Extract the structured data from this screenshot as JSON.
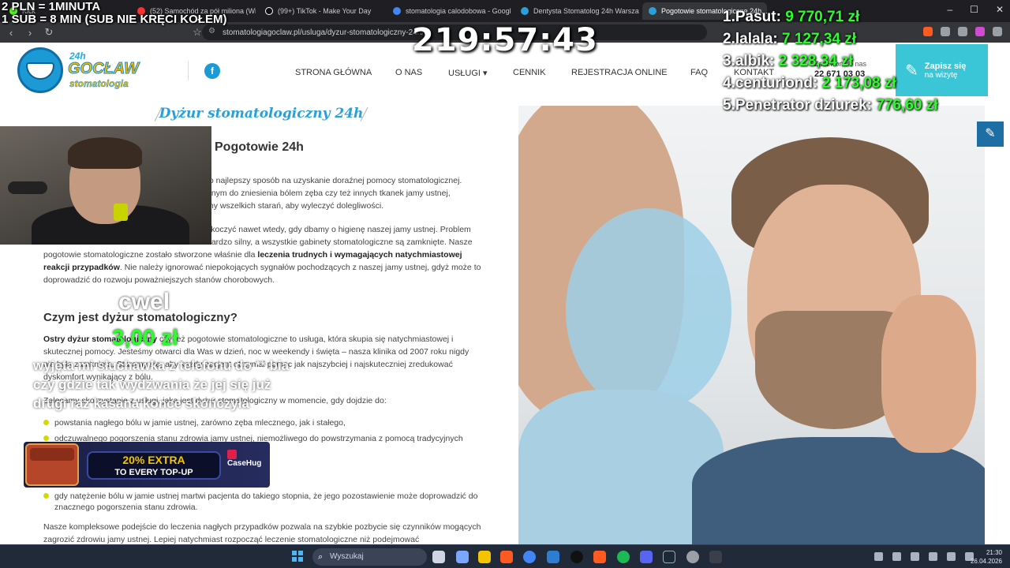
{
  "browser": {
    "tabs": [
      {
        "label": "Kick",
        "color": "#53fc18",
        "active": false
      },
      {
        "label": "(52) Samochód za pół miliona (Wier...",
        "color": "#ff3030",
        "active": false
      },
      {
        "label": "(99+) TikTok - Make Your Day",
        "color": "#ffffff",
        "active": false
      },
      {
        "label": "stomatologia calodobowa - Google S...",
        "color": "#4285f4",
        "active": false
      },
      {
        "label": "Dentysta Stomatolog 24h Warszawa...",
        "color": "#2a9fd8",
        "active": false
      },
      {
        "label": "Pogotowie stomatologiczne 24h...",
        "color": "#2a9fd8",
        "active": true
      }
    ],
    "url": "stomatologiagoclaw.pl/usluga/dyzur-stomatologiczny-24h/"
  },
  "site": {
    "logo": {
      "badge": "24h",
      "name": "GOCŁAW",
      "sub": "stomatologia"
    },
    "fb": "f",
    "nav": [
      "STRONA GŁÓWNA",
      "O NAS",
      "USŁUGI ▾",
      "CENNIK",
      "REJESTRACJA ONLINE",
      "FAQ",
      "KONTAKT"
    ],
    "phone_label": "Zadzwoń do nas",
    "phone": "22 671 03 03",
    "cta": {
      "line1": "Zapisz się",
      "line2": "na wizytę"
    },
    "page_heading": "Dyżur stomatologiczny 24h",
    "h1": "Pogotowie 24h",
    "intro": [
      "to najlepszy sposób na uzyskanie doraźnej pomocy stomatologicznej.",
      "dnym do zniesienia bólem zęba czy też innych tkanek jamy ustnej,",
      "my wszelkich starań, aby wyleczyć dolegliwości."
    ],
    "p2_lines": [
      "skoczyć nawet wtedy, gdy dbamy o higienę naszej jamy ustnej. Problem",
      "bardzo silny, a wszystkie gabinety stomatologiczne są zamknięte. Nasze"
    ],
    "p2_a": "pogotowie stomatologiczne zostało stworzone właśnie dla ",
    "p2_b": "leczenia trudnych i wymagających natychmiastowej reakcji przypadków",
    "p2_c": ". Nie należy ignorować niepokojących sygnałów pochodzących z naszej jamy ustnej, gdyż może to doprowadzić do rozwoju poważniejszych stanów chorobowych.",
    "h2": "Czym jest dyżur stomatologiczny?",
    "p3_a": "Ostry dyżur stomatologiczny",
    "p3_b": " czy też pogotowie stomatologiczne to usługa, która skupia się natychmiastowej i skutecznej pomocy. Jesteśmy otwarci dla Was w dzień, noc w weekendy i święta – nasza klinika od 2007 roku nigdy nie była zamknięta. Staramy się, aby każdy pacjent otrzymał pomoc jak najszybciej i najskuteczniej zredukować dyskomfort wynikający z bólu.",
    "p4": "Zalecamy skorzystanie z usługi, jaką jest dyżur stomatologiczny w momencie, gdy dojdzie do:",
    "bullet1": "powstania nagłego bólu w jamie ustnej, zarówno zęba mlecznego, jak i stałego,",
    "bullet2": "odczuwalnego pogorszenia stanu zdrowia jamy ustnej, niemożliwego do powstrzymania z pomocą tradycyjnych",
    "bullet3": "gdy natężenie bólu w jamie ustnej martwi pacjenta do takiego stopnia, że jego pozostawienie może doprowadzić do znacznego pogorszenia stanu zdrowia.",
    "p5": "Nasze kompleksowe podejście do leczenia nagłych przypadków pozwala na szybkie pozbycie się czynników mogących zagrozić zdrowiu jamy ustnej. Lepiej natychmiast rozpocząć leczenie stomatologiczne niż podejmować"
  },
  "overlay": {
    "rate1": "2 PLN = 1MINUTA",
    "rate2": "1 SUB = 8 MIN (SUB NIE KRĘCI KOŁEM)",
    "timer": "219:57:43",
    "leaderboard": [
      {
        "name": "1.Pasut:",
        "amount": "9 770,71 zł"
      },
      {
        "name": "2.lalala:",
        "amount": "7 127,34 zł"
      },
      {
        "name": "3.albik:",
        "amount": "2 328,34 zł"
      },
      {
        "name": "4.centuriond:",
        "amount": "2 173,08 zł"
      },
      {
        "name": "5.Penetrator dziurek:",
        "amount": "776,60 zł"
      }
    ],
    "donation": {
      "name": "cwel",
      "amount": "3,00 zł",
      "message": "wyjęta mi słuchawka z telefonu do ** bia czy gdzie tak wydzwania że jej się już drugi raz kasana konce skończyła"
    },
    "ad": {
      "line1": "20% EXTRA",
      "line2": "TO EVERY TOP-UP",
      "brand": "CaseHug"
    }
  },
  "taskbar": {
    "search_placeholder": "Wyszukaj",
    "time": "21:30",
    "date": "26.04.2026"
  }
}
